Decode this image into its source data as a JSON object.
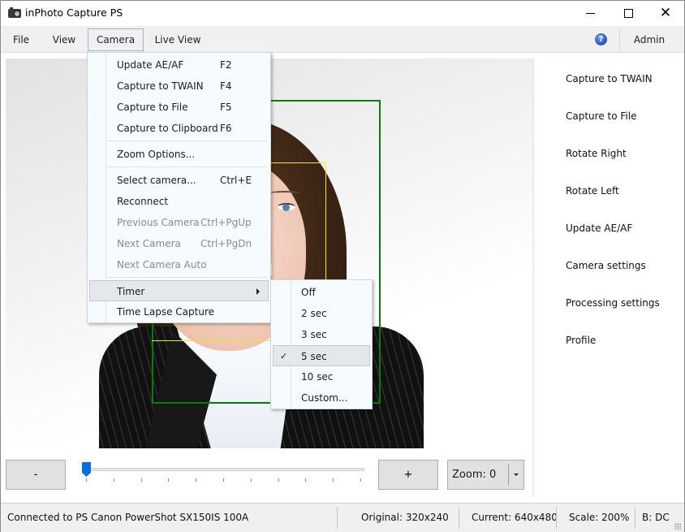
{
  "window": {
    "title": "inPhoto Capture PS",
    "controls": {
      "minimize": "minimize",
      "maximize": "maximize",
      "close": "✕"
    }
  },
  "menubar": {
    "items": [
      {
        "label": "File"
      },
      {
        "label": "View"
      },
      {
        "label": "Camera",
        "open": true
      },
      {
        "label": "Live View"
      }
    ],
    "help_icon": "?",
    "admin_label": "Admin"
  },
  "camera_menu": {
    "items": [
      {
        "label": "Update AE/AF",
        "shortcut": "F2",
        "enabled": true
      },
      {
        "label": "Capture to TWAIN",
        "shortcut": "F4",
        "enabled": true
      },
      {
        "label": "Capture to File",
        "shortcut": "F5",
        "enabled": true
      },
      {
        "label": "Capture to Clipboard",
        "shortcut": "F6",
        "enabled": true
      },
      {
        "label": "Zoom Options...",
        "shortcut": "",
        "enabled": true
      },
      {
        "label": "Select camera...",
        "shortcut": "Ctrl+E",
        "enabled": true
      },
      {
        "label": "Reconnect",
        "shortcut": "",
        "enabled": true
      },
      {
        "label": "Previous Camera",
        "shortcut": "Ctrl+PgUp",
        "enabled": false
      },
      {
        "label": "Next Camera",
        "shortcut": "Ctrl+PgDn",
        "enabled": false
      },
      {
        "label": "Next Camera Auto",
        "shortcut": "",
        "enabled": false
      },
      {
        "label": "Timer",
        "shortcut": "",
        "enabled": true,
        "submenu": true,
        "highlighted": true
      },
      {
        "label": "Time Lapse Capture",
        "shortcut": "",
        "enabled": true
      }
    ]
  },
  "timer_menu": {
    "items": [
      {
        "label": "Off",
        "checked": false
      },
      {
        "label": "2 sec",
        "checked": false
      },
      {
        "label": "3 sec",
        "checked": false
      },
      {
        "label": "5 sec",
        "checked": true
      },
      {
        "label": "10 sec",
        "checked": false
      },
      {
        "label": "Custom...",
        "checked": false
      }
    ],
    "check_glyph": "✓"
  },
  "right_panel": {
    "actions": [
      {
        "label": "Capture to TWAIN"
      },
      {
        "label": "Capture to File"
      },
      {
        "label": "Rotate Right"
      },
      {
        "label": "Rotate Left"
      },
      {
        "label": "Update AE/AF"
      },
      {
        "label": "Camera settings"
      },
      {
        "label": "Processing settings"
      },
      {
        "label": "Profile"
      }
    ]
  },
  "controls": {
    "minus_label": "-",
    "plus_label": "+",
    "zoom_value": "Zoom: 0",
    "slider_value_fraction": 0.0,
    "slider_tick_count": 11
  },
  "statusbar": {
    "connection": "Connected to PS Canon PowerShot SX150IS 100A",
    "original": "Original: 320x240",
    "current": "Current: 640x480",
    "scale": "Scale: 200%",
    "mode": "B: DC"
  },
  "colors": {
    "face_frame": "#0a7a0a",
    "focus_frame": "#f0e62a",
    "slider_thumb": "#0a6fd8",
    "menu_bg": "#f7fbfe"
  }
}
